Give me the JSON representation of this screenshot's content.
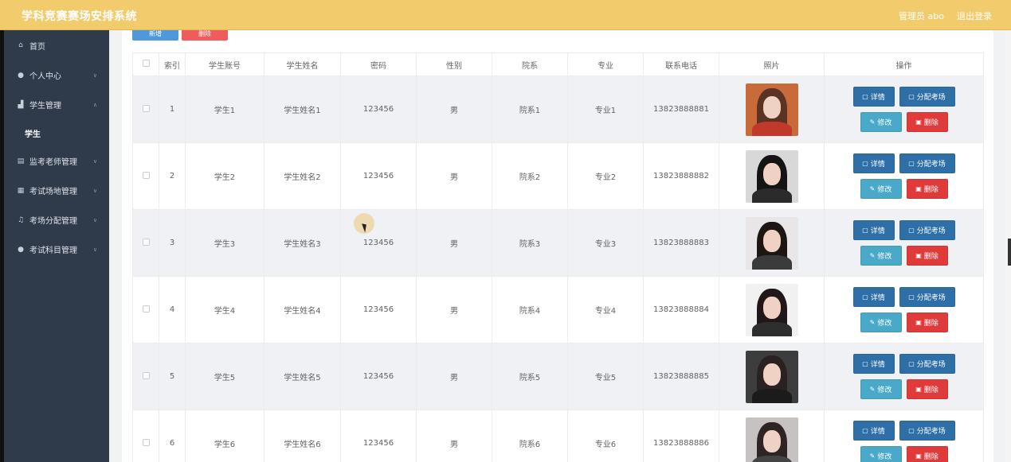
{
  "header": {
    "app_title": "学科竞赛赛场安排系统",
    "user_label": "管理员 abo",
    "logout_label": "退出登录"
  },
  "sidebar": {
    "items": [
      {
        "label": "首页",
        "icon": "home-icon",
        "expandable": false
      },
      {
        "label": "个人中心",
        "icon": "user-icon",
        "expandable": true
      },
      {
        "label": "学生管理",
        "icon": "students-icon",
        "expandable": true,
        "expanded": true,
        "children": [
          {
            "label": "学生"
          }
        ]
      },
      {
        "label": "监考老师管理",
        "icon": "keyboard-icon",
        "expandable": true
      },
      {
        "label": "考试场地管理",
        "icon": "venue-icon",
        "expandable": true
      },
      {
        "label": "考场分配管理",
        "icon": "bell-icon",
        "expandable": true
      },
      {
        "label": "考试科目管理",
        "icon": "user-icon",
        "expandable": true
      }
    ]
  },
  "toolbar": {
    "add_label": "新增",
    "delete_label": "删除"
  },
  "table": {
    "columns": [
      "索引",
      "学生账号",
      "学生姓名",
      "密码",
      "性别",
      "院系",
      "专业",
      "联系电话",
      "照片",
      "操作"
    ],
    "rows": [
      {
        "index": "1",
        "account": "学生1",
        "name": "学生姓名1",
        "password": "123456",
        "gender": "男",
        "dept": "院系1",
        "major": "专业1",
        "phone": "13823888881"
      },
      {
        "index": "2",
        "account": "学生2",
        "name": "学生姓名2",
        "password": "123456",
        "gender": "男",
        "dept": "院系2",
        "major": "专业2",
        "phone": "13823888882"
      },
      {
        "index": "3",
        "account": "学生3",
        "name": "学生姓名3",
        "password": "123456",
        "gender": "男",
        "dept": "院系3",
        "major": "专业3",
        "phone": "13823888883"
      },
      {
        "index": "4",
        "account": "学生4",
        "name": "学生姓名4",
        "password": "123456",
        "gender": "男",
        "dept": "院系4",
        "major": "专业4",
        "phone": "13823888884"
      },
      {
        "index": "5",
        "account": "学生5",
        "name": "学生姓名5",
        "password": "123456",
        "gender": "男",
        "dept": "院系5",
        "major": "专业5",
        "phone": "13823888885"
      },
      {
        "index": "6",
        "account": "学生6",
        "name": "学生姓名6",
        "password": "123456",
        "gender": "男",
        "dept": "院系6",
        "major": "专业6",
        "phone": "13823888886"
      }
    ],
    "actions": {
      "detail": "详情",
      "assign": "分配考场",
      "edit": "修改",
      "delete": "删除"
    }
  },
  "colors": {
    "header_bg": "#f2cc6c",
    "sidebar_bg": "#2f3a4b",
    "primary_btn": "#2f6fa8",
    "edit_btn": "#4aa8c8",
    "danger_btn": "#e03b3b"
  }
}
